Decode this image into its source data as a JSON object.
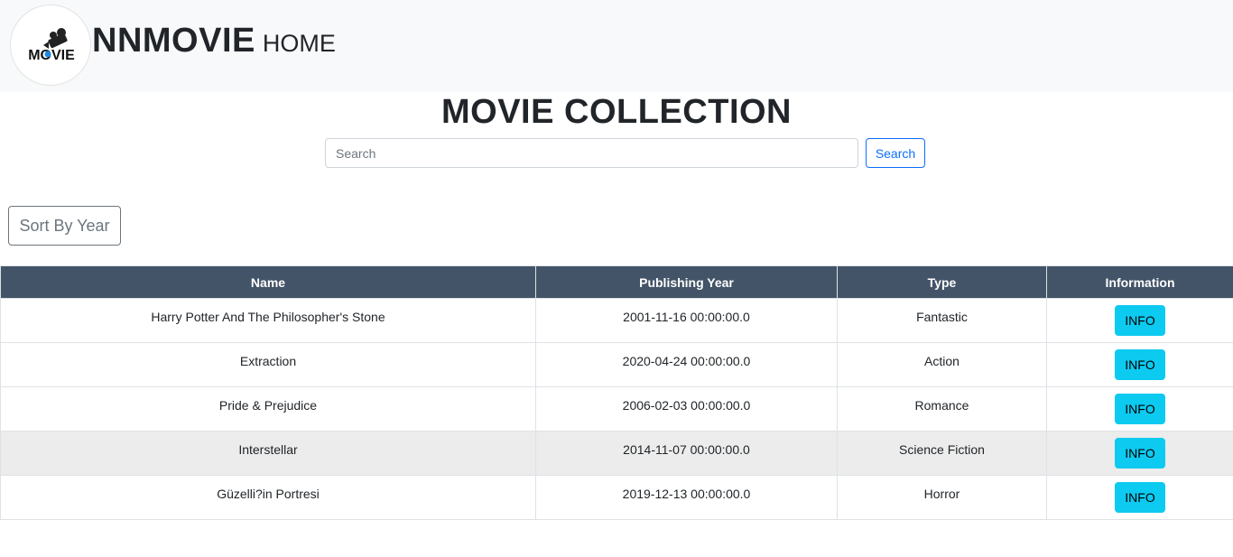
{
  "navbar": {
    "logo_text": "MOVIE",
    "brand_name": "NNMOVIE",
    "home_link": "HOME"
  },
  "page": {
    "title": "MOVIE COLLECTION"
  },
  "search": {
    "placeholder": "Search",
    "value": "",
    "button_label": "Search"
  },
  "sort": {
    "button_label": "Sort By Year"
  },
  "table": {
    "headers": {
      "name": "Name",
      "year": "Publishing Year",
      "type": "Type",
      "info": "Information"
    },
    "rows": [
      {
        "name": "Harry Potter And The Philosopher's Stone",
        "year": "2001-11-16 00:00:00.0",
        "type": "Fantastic",
        "info_label": "INFO"
      },
      {
        "name": "Extraction",
        "year": "2020-04-24 00:00:00.0",
        "type": "Action",
        "info_label": "INFO"
      },
      {
        "name": "Pride & Prejudice",
        "year": "2006-02-03 00:00:00.0",
        "type": "Romance",
        "info_label": "INFO"
      },
      {
        "name": "Interstellar",
        "year": "2014-11-07 00:00:00.0",
        "type": "Science Fiction",
        "info_label": "INFO"
      },
      {
        "name": "Güzelli?in Portresi",
        "year": "2019-12-13 00:00:00.0",
        "type": "Horror",
        "info_label": "INFO"
      }
    ]
  },
  "colors": {
    "table_header_bg": "#435468",
    "info_button_bg": "#0dcaf0",
    "search_button_border": "#0d6efd",
    "navbar_bg": "#f8f9fa"
  }
}
